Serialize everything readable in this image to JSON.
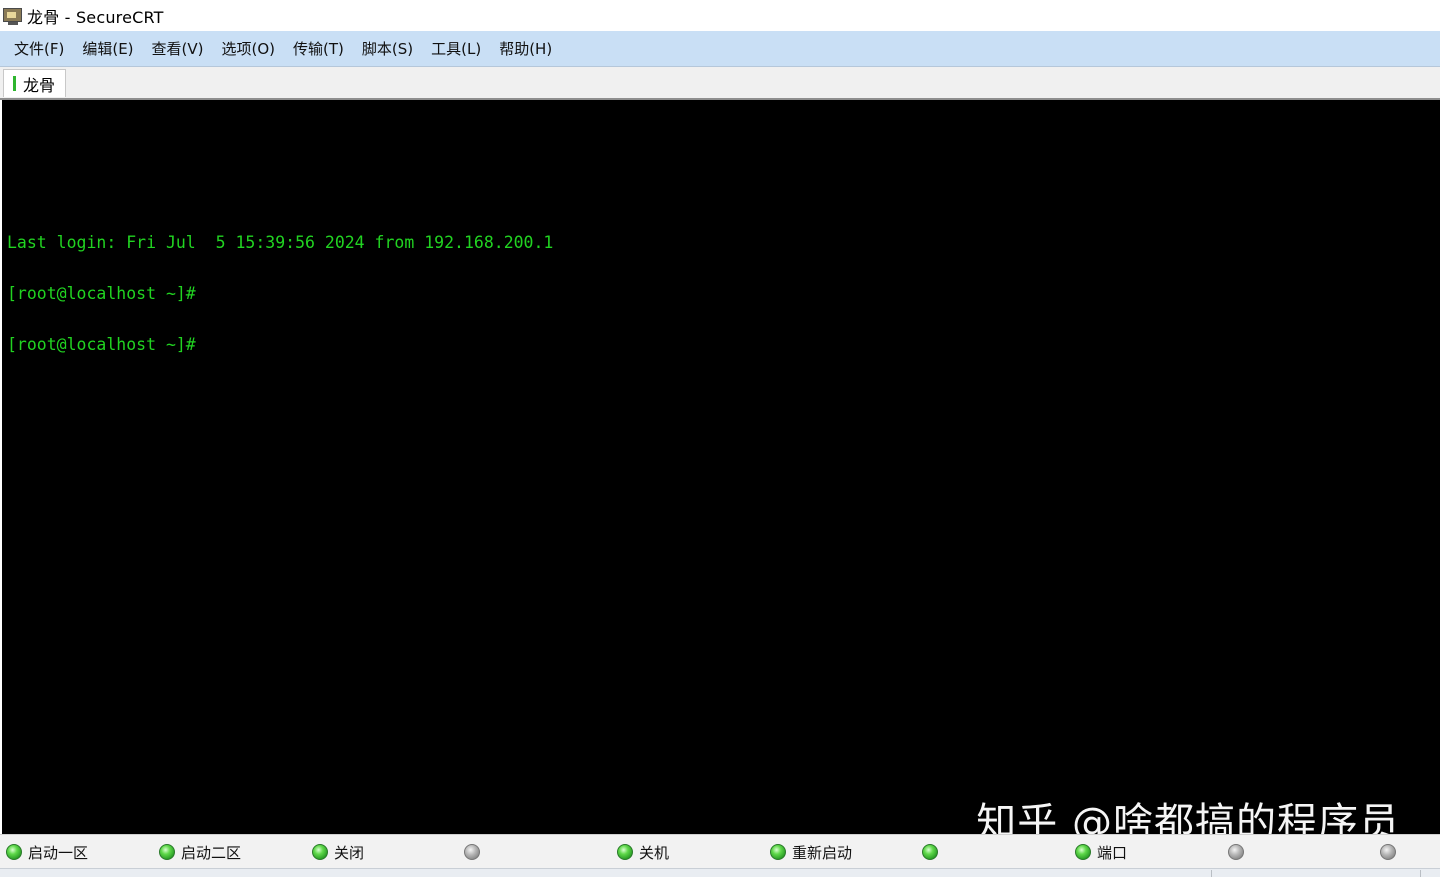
{
  "window": {
    "title": "龙骨 - SecureCRT",
    "icon": "securecrt-monitor-icon"
  },
  "menu": [
    {
      "label": "文件(F)"
    },
    {
      "label": "编辑(E)"
    },
    {
      "label": "查看(V)"
    },
    {
      "label": "选项(O)"
    },
    {
      "label": "传输(T)"
    },
    {
      "label": "脚本(S)"
    },
    {
      "label": "工具(L)"
    },
    {
      "label": "帮助(H)"
    }
  ],
  "tabs": [
    {
      "label": "龙骨",
      "status_color": "#2fb52f"
    }
  ],
  "terminal": {
    "background": "#000000",
    "foreground": "#21d321",
    "lines": [
      "Last login: Fri Jul  5 15:39:56 2024 from 192.168.200.1",
      "[root@localhost ~]#",
      "[root@localhost ~]#"
    ]
  },
  "watermark": "知乎 @啥都搞的程序员",
  "button_bar": [
    {
      "label": "启动一区",
      "status": "green",
      "icon": "green-led-icon"
    },
    {
      "label": "启动二区",
      "status": "green",
      "icon": "green-led-icon"
    },
    {
      "label": "关闭",
      "status": "green",
      "icon": "green-led-icon"
    },
    {
      "label": "",
      "status": "gray",
      "icon": "gray-led-icon"
    },
    {
      "label": "关机",
      "status": "green",
      "icon": "green-led-icon"
    },
    {
      "label": "重新启动",
      "status": "green",
      "icon": "green-led-icon"
    },
    {
      "label": "",
      "status": "green",
      "icon": "green-led-icon"
    },
    {
      "label": "端口",
      "status": "green",
      "icon": "green-led-icon"
    },
    {
      "label": "",
      "status": "gray",
      "icon": "gray-led-icon"
    },
    {
      "label": "",
      "status": "gray",
      "icon": "gray-led-icon"
    }
  ]
}
